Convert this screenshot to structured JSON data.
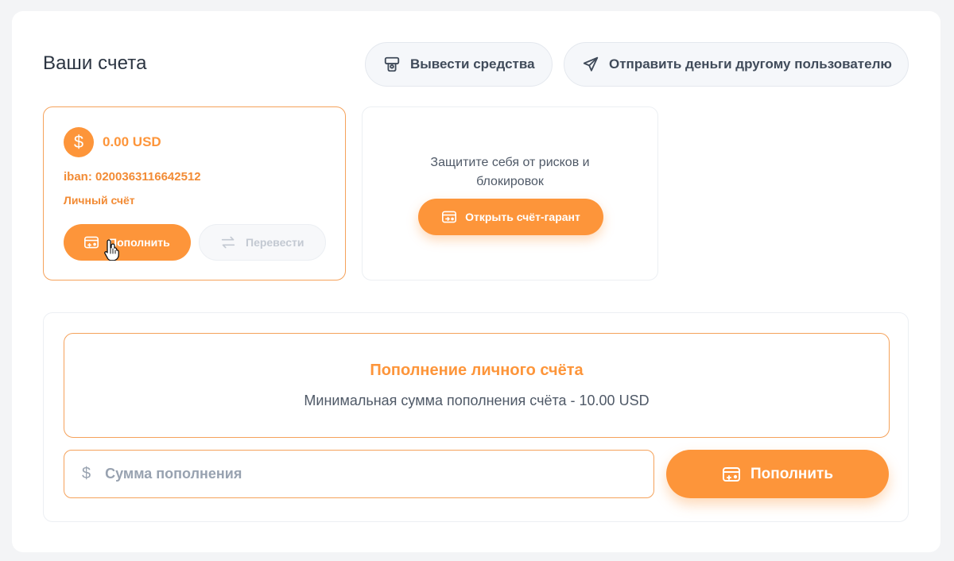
{
  "header": {
    "title": "Ваши счета",
    "withdraw_label": "Вывести средства",
    "send_label": "Отправить деньги другому пользователю"
  },
  "account": {
    "currency_symbol": "$",
    "balance": "0.00 USD",
    "iban": "iban: 0200363116642512",
    "type": "Личный счёт",
    "topup_label": "Пополнить",
    "transfer_label": "Перевести"
  },
  "guarantee": {
    "text_line1": "Защитите себя от рисков и",
    "text_line2": "блокировок",
    "button_label": "Открыть счёт-гарант"
  },
  "topup": {
    "title": "Пополнение личного счёта",
    "subtitle": "Минимальная сумма пополнения счёта - 10.00 USD",
    "currency_symbol": "$",
    "amount_placeholder": "Сумма пополнения",
    "amount_value": "",
    "submit_label": "Пополнить"
  },
  "colors": {
    "accent": "#fd953a",
    "border_accent": "#f5a25b",
    "text": "#2b3441",
    "muted": "#98a2b0"
  }
}
